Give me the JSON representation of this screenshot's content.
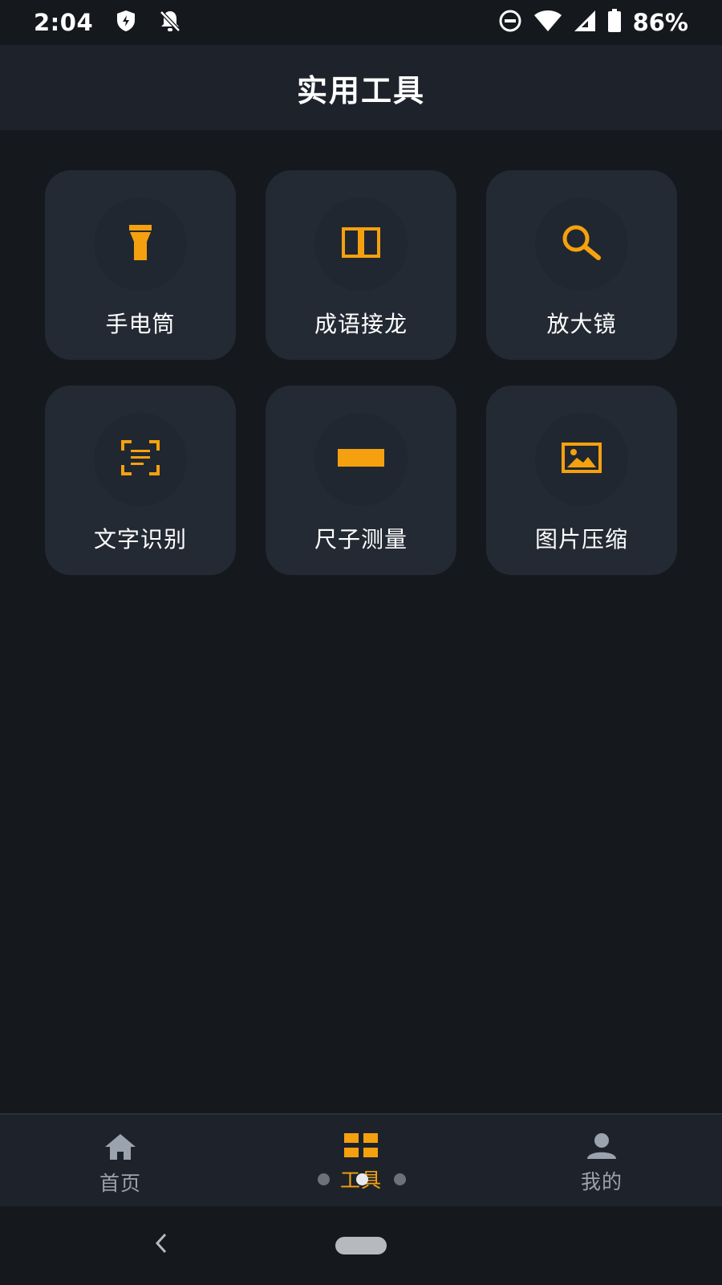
{
  "status_bar": {
    "time": "2:04",
    "battery": "86%"
  },
  "header": {
    "title": "实用工具"
  },
  "tools": [
    {
      "label": "手电筒",
      "icon": "flashlight-icon"
    },
    {
      "label": "成语接龙",
      "icon": "book-icon"
    },
    {
      "label": "放大镜",
      "icon": "magnifier-icon"
    },
    {
      "label": "文字识别",
      "icon": "text-scan-icon"
    },
    {
      "label": "尺子测量",
      "icon": "ruler-icon"
    },
    {
      "label": "图片压缩",
      "icon": "image-icon"
    }
  ],
  "bottom_nav": {
    "items": [
      {
        "label": "首页",
        "icon": "home-icon",
        "active": false
      },
      {
        "label": "工具",
        "icon": "grid-icon",
        "active": true
      },
      {
        "label": "我的",
        "icon": "person-icon",
        "active": false
      }
    ]
  },
  "colors": {
    "accent": "#f5a10f",
    "background": "#15181d",
    "card": "#232a33",
    "header": "#1e232b"
  }
}
